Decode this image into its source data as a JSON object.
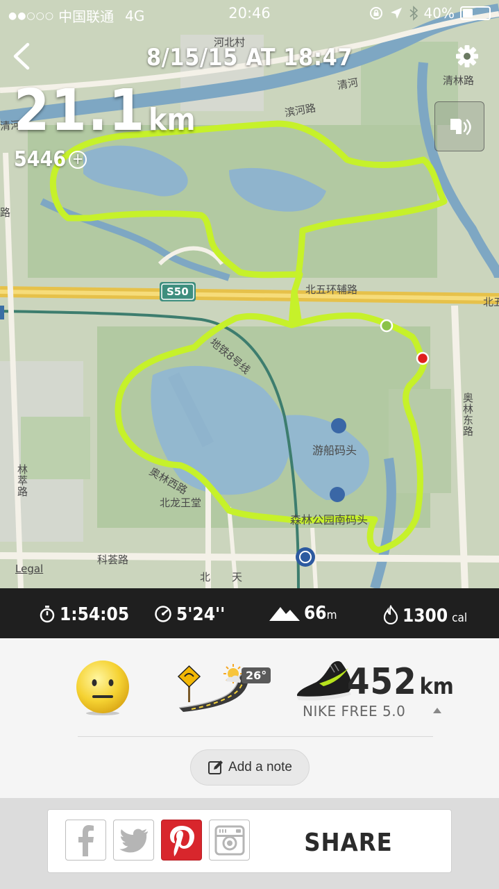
{
  "status_bar": {
    "signal_dots": "●●○○○",
    "carrier": "中国联通",
    "network": "4G",
    "time": "20:46",
    "battery_percent": "40%",
    "battery_level": 0.4
  },
  "header": {
    "date": "8/15/15 AT 18:47"
  },
  "run": {
    "distance_value": "21.1",
    "distance_unit": "km",
    "nikefuel": "5446"
  },
  "map": {
    "route_color": "#c6f12a",
    "start_color": "#8bc34a",
    "end_color": "#e0201f",
    "labels": {
      "hebeicun": "河北村",
      "qinglin_road": "清林路",
      "qinghe": "清河",
      "binhe_road": "滨河路",
      "qinghe_left": "清河",
      "s50": "S50",
      "beiwuhuan": "北五环辅路",
      "beiwu_right": "北五",
      "subway": "地铁8号线",
      "boat_dock": "游船码头",
      "forest_dock": "森林公园南码头",
      "aolin_west": "奥林西路",
      "aolin_east": "奥林东路",
      "linchui_road": "林萃路",
      "beilongwangtang": "北龙王堂",
      "kehui_road": "科荟路",
      "bei": "北",
      "tian": "天",
      "left_road": "路",
      "legal": "Legal"
    }
  },
  "stats": {
    "duration": "1:54:05",
    "pace": "5'24''",
    "elevation_value": "66",
    "elevation_unit": "m",
    "calories_value": "1300",
    "calories_unit": "cal"
  },
  "summary": {
    "mood_icon": "neutral-face",
    "terrain_icon": "road",
    "weather_icon": "sun-cloud",
    "temperature": "26°",
    "shoe_distance_value": "452",
    "shoe_distance_unit": "km",
    "shoe_name": "NIKE FREE 5.0",
    "add_note_label": "Add a note"
  },
  "share": {
    "label": "SHARE",
    "buttons": [
      "facebook",
      "twitter",
      "pinterest",
      "camera"
    ],
    "pinterest_color": "#d8262c"
  }
}
